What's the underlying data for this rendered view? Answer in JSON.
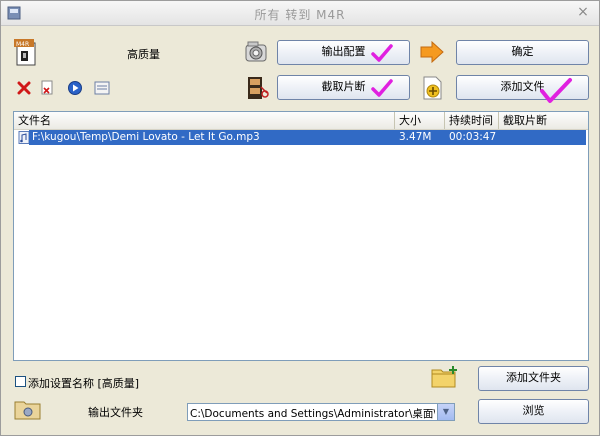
{
  "window": {
    "title": "所有 转到 M4R",
    "close_glyph": "×"
  },
  "toolbar": {
    "quality_label": "高质量",
    "output_config_label": "输出配置",
    "ok_label": "确定",
    "clip_label": "截取片断",
    "add_file_label": "添加文件"
  },
  "file_list": {
    "columns": [
      "文件名",
      "大小",
      "持续时间",
      "截取片断"
    ],
    "rows": [
      {
        "name": "F:\\kugou\\Temp\\Demi Lovato - Let It Go.mp3",
        "size": "3.47M",
        "duration": "00:03:47",
        "clip": ""
      }
    ]
  },
  "footer": {
    "add_setting_label": "添加设置名称 [高质量]",
    "add_setting_checked": false,
    "add_folder_label": "添加文件夹",
    "output_folder_label": "输出文件夹",
    "output_path": "C:\\Documents and Settings\\Administrator\\桌面\\聊岩小请新的",
    "browse_label": "浏览"
  },
  "colors": {
    "selection": "#316ac5",
    "check_mark": "#e020e0",
    "window_bg": "#ece9d8"
  }
}
